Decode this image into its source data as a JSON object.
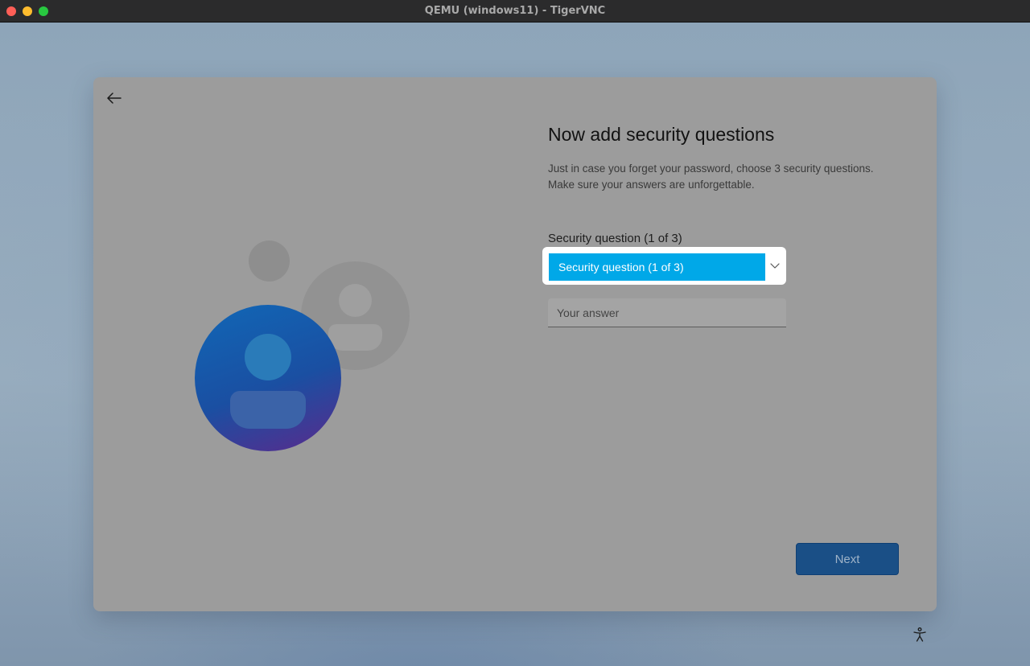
{
  "window": {
    "title": "QEMU (windows11) - TigerVNC"
  },
  "page": {
    "heading": "Now add security questions",
    "description_line1": "Just in case you forget your password, choose 3 security questions.",
    "description_line2": "Make sure your answers are unforgettable.",
    "question_label": "Security question (1 of 3)",
    "question_selected": "Security question (1 of 3)",
    "answer_placeholder": "Your answer",
    "next_label": "Next"
  },
  "icons": {
    "back": "back-arrow-icon",
    "dropdown": "chevron-down-icon",
    "accessibility": "accessibility-icon"
  },
  "colors": {
    "selected_highlight": "#00a8e8",
    "next_button": "#1a4f86",
    "avatar_blue": "#1167b6"
  }
}
